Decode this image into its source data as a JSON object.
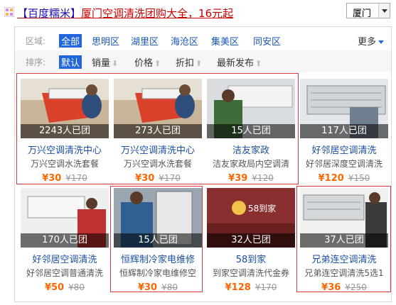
{
  "header": {
    "bracket_open": "【",
    "brand": "百度糯米",
    "bracket_close": "】",
    "title": "厦门空调清洗团购大全，16元起",
    "city": "厦门"
  },
  "filters": {
    "area_label": "区域:",
    "areas": [
      "全部",
      "思明区",
      "湖里区",
      "海沧区",
      "集美区",
      "同安区"
    ],
    "more_label": "更多",
    "sort_label": "排序:",
    "sorts": [
      {
        "label": "默认",
        "arrow": ""
      },
      {
        "label": "销量",
        "arrow": "⬇"
      },
      {
        "label": "价格",
        "arrow": "⬆"
      },
      {
        "label": "折扣",
        "arrow": "⬆"
      },
      {
        "label": "最新发布",
        "arrow": "⬆"
      }
    ]
  },
  "products": [
    {
      "count": "2243人已团",
      "title": "万兴空调清洗中心",
      "desc": "万兴空调水洗套餐",
      "price": "¥30",
      "old_price": "¥170"
    },
    {
      "count": "273人已团",
      "title": "万兴空调清洗中心",
      "desc": "万兴空调水洗套餐",
      "price": "¥30",
      "old_price": "¥170"
    },
    {
      "count": "15人已团",
      "title": "洁友家政",
      "desc": "洁友家政局内空调清",
      "price": "¥39",
      "old_price": "¥120"
    },
    {
      "count": "117人已团",
      "title": "好邻居空调清洗",
      "desc": "好邻居深度空调清洗",
      "price": "¥120",
      "old_price": "¥150"
    },
    {
      "count": "170人已团",
      "title": "好邻居空调清洗",
      "desc": "好邻居空调普通清洗",
      "price": "¥50",
      "old_price": "¥80"
    },
    {
      "count": "15人已团",
      "title": "恒辉制冷家电维修",
      "desc": "恒辉制冷家电维修空",
      "price": "¥30",
      "old_price": "¥80"
    },
    {
      "count": "32人已团",
      "title": "58到家",
      "desc": "到家空调清洗代金券",
      "price": "¥128",
      "old_price": "¥170"
    },
    {
      "count": "37人已团",
      "title": "兄弟连空调清洗",
      "desc": "兄弟连空调清洗5选1",
      "price": "¥36",
      "old_price": "¥250"
    }
  ],
  "images": {
    "logo_text": "58到家"
  },
  "colors": {
    "link_blue": "#1a55b0",
    "active_blue": "#2266dd",
    "price_orange": "#ff6600",
    "highlight_red": "#d9383f"
  }
}
